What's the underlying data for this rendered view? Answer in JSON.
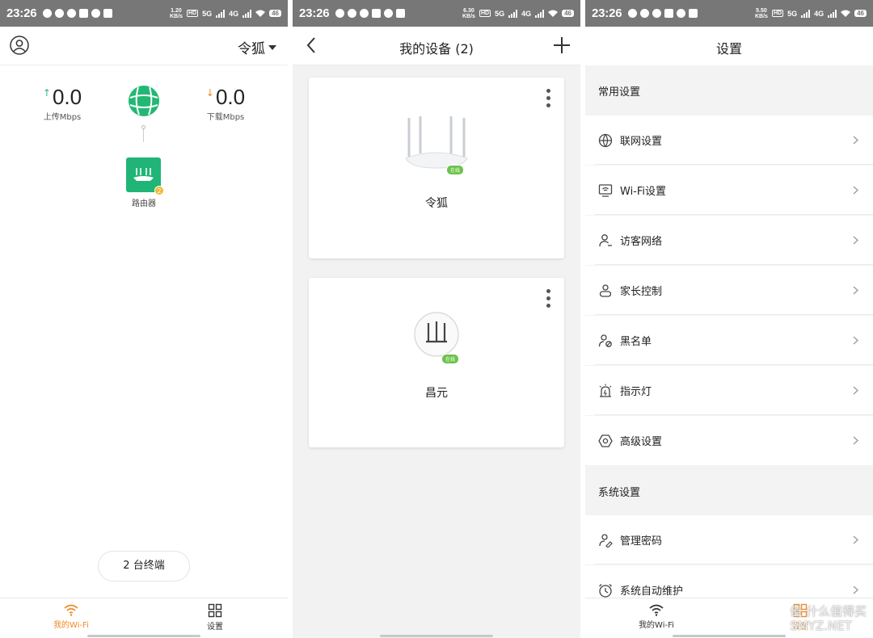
{
  "status_bars": [
    {
      "time": "23:26",
      "speed": "1.20\nKB/s",
      "battery": "46"
    },
    {
      "time": "23:26",
      "speed": "6.30\nKB/s",
      "battery": "46"
    },
    {
      "time": "23:26",
      "speed": "5.50\nKB/s",
      "battery": "46"
    }
  ],
  "status_icons": {
    "hd": "HD",
    "net": "5G",
    "net2": "4G"
  },
  "screen1": {
    "network_name": "令狐",
    "upload": {
      "value": "0.0",
      "label": "上传Mbps",
      "arrow": "↑"
    },
    "download": {
      "value": "0.0",
      "label": "下载Mbps",
      "arrow": "↓"
    },
    "router_label": "路由器",
    "router_badge": "2",
    "clients_button": "2 台终端",
    "tabs": [
      {
        "label": "我的Wi-Fi",
        "icon": "wifi-icon",
        "active": true
      },
      {
        "label": "设置",
        "icon": "grid-icon",
        "active": false
      }
    ]
  },
  "screen2": {
    "title": "我的设备 (2)",
    "devices": [
      {
        "name": "令狐",
        "status": "在线"
      },
      {
        "name": "昌元",
        "status": "在线"
      }
    ]
  },
  "screen3": {
    "title": "设置",
    "sections": [
      {
        "title": "常用设置",
        "items": [
          {
            "label": "联网设置",
            "icon": "globe-icon"
          },
          {
            "label": "Wi-Fi设置",
            "icon": "wifi-monitor-icon"
          },
          {
            "label": "访客网络",
            "icon": "guest-icon"
          },
          {
            "label": "家长控制",
            "icon": "parental-icon"
          },
          {
            "label": "黑名单",
            "icon": "blacklist-icon"
          },
          {
            "label": "指示灯",
            "icon": "light-icon"
          },
          {
            "label": "高级设置",
            "icon": "hexagon-gear-icon"
          }
        ]
      },
      {
        "title": "系统设置",
        "items": [
          {
            "label": "管理密码",
            "icon": "password-icon"
          },
          {
            "label": "系统自动维护",
            "icon": "clock-icon"
          }
        ]
      }
    ],
    "tabs": [
      {
        "label": "我的Wi-Fi",
        "icon": "wifi-icon",
        "active": false
      },
      {
        "label": "设置",
        "icon": "grid-icon",
        "active": true
      }
    ],
    "watermark": "值 什么值得买\nSMYZ.NET"
  },
  "colors": {
    "accent_orange": "#f08a24",
    "green": "#20b576",
    "online_green": "#6cc24a",
    "upload_green": "#2fb380"
  }
}
